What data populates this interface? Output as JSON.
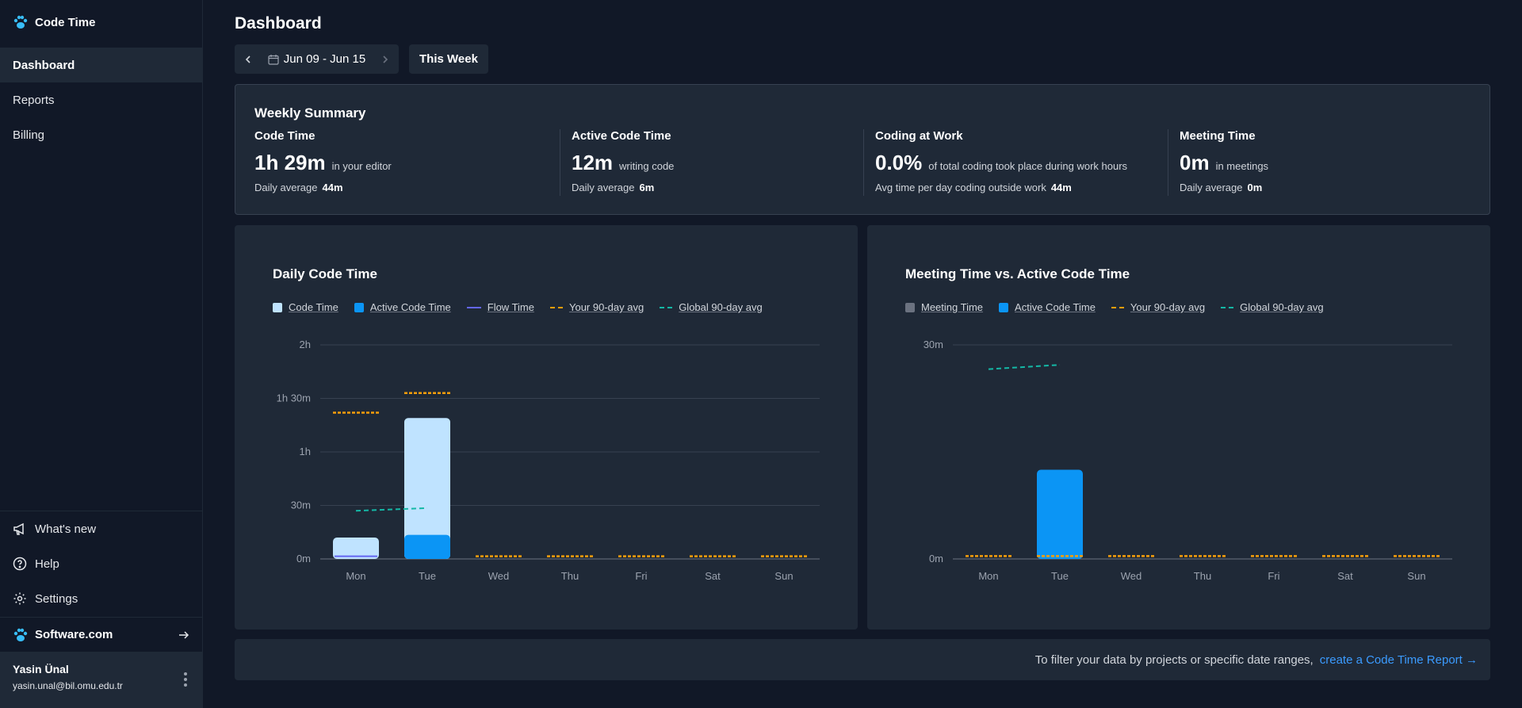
{
  "app": {
    "title": "Code Time"
  },
  "sidebar": {
    "nav": [
      {
        "label": "Dashboard",
        "active": true
      },
      {
        "label": "Reports"
      },
      {
        "label": "Billing"
      }
    ],
    "bottom": [
      {
        "label": "What's new",
        "icon": "megaphone-icon"
      },
      {
        "label": "Help",
        "icon": "help-icon"
      },
      {
        "label": "Settings",
        "icon": "gear-icon"
      }
    ],
    "software": "Software.com",
    "user": {
      "name": "Yasin Ünal",
      "email": "yasin.unal@bil.omu.edu.tr"
    }
  },
  "header": {
    "title": "Dashboard",
    "date_range": "Jun 09 - Jun 15",
    "this_week": "This Week"
  },
  "summary": {
    "title": "Weekly Summary",
    "metrics": [
      {
        "head": "Code Time",
        "value": "1h 29m",
        "sub": "in your editor",
        "avg_label": "Daily average",
        "avg": "44m"
      },
      {
        "head": "Active Code Time",
        "value": "12m",
        "sub": "writing code",
        "avg_label": "Daily average",
        "avg": "6m"
      },
      {
        "head": "Coding at Work",
        "value": "0.0%",
        "sub": "of total coding took place during work hours",
        "avg_label": "Avg time per day coding outside work",
        "avg": "44m"
      },
      {
        "head": "Meeting Time",
        "value": "0m",
        "sub": "in meetings",
        "avg_label": "Daily average",
        "avg": "0m"
      }
    ]
  },
  "colors": {
    "code_time": "#bfe3ff",
    "active_code_time": "#0b95f5",
    "flow_time": "#6366f1",
    "your_avg": "#f59e0b",
    "global_avg": "#14b8a6",
    "meeting_time": "#6b7280"
  },
  "chart_data": [
    {
      "type": "bar",
      "title": "Daily Code Time",
      "legend": [
        "Code Time",
        "Active Code Time",
        "Flow Time",
        "Your 90-day avg",
        "Global 90-day avg"
      ],
      "categories": [
        "Mon",
        "Tue",
        "Wed",
        "Thu",
        "Fri",
        "Sat",
        "Sun"
      ],
      "yticks": [
        "0m",
        "30m",
        "1h",
        "1h 30m",
        "2h"
      ],
      "ylim": [
        0,
        120
      ],
      "series": [
        {
          "name": "Code Time",
          "values": [
            12,
            79,
            0,
            0,
            0,
            0,
            0
          ]
        },
        {
          "name": "Active Code Time",
          "values": [
            0,
            13.5,
            0,
            0,
            0,
            0,
            0
          ]
        },
        {
          "name": "Flow Time",
          "values": [
            1.5,
            0,
            0,
            0,
            0,
            0,
            0
          ]
        },
        {
          "name": "Your 90-day avg",
          "values": [
            82,
            93,
            1.5,
            1.5,
            1.5,
            1.5,
            1.5
          ]
        },
        {
          "name": "Global 90-day avg",
          "values": [
            27,
            28.5,
            null,
            null,
            null,
            null,
            null
          ]
        }
      ]
    },
    {
      "type": "bar",
      "title": "Meeting Time vs. Active Code Time",
      "legend": [
        "Meeting Time",
        "Active Code Time",
        "Your 90-day avg",
        "Global 90-day avg"
      ],
      "categories": [
        "Mon",
        "Tue",
        "Wed",
        "Thu",
        "Fri",
        "Sat",
        "Sun"
      ],
      "yticks": [
        "0m",
        "30m"
      ],
      "ylim": [
        0,
        30
      ],
      "series": [
        {
          "name": "Meeting Time",
          "values": [
            0,
            0,
            0,
            0,
            0,
            0,
            0
          ]
        },
        {
          "name": "Active Code Time",
          "values": [
            0,
            12.5,
            0,
            0,
            0,
            0,
            0
          ]
        },
        {
          "name": "Your 90-day avg",
          "values": [
            0.4,
            0.4,
            0.4,
            0.4,
            0.4,
            0.4,
            0.4
          ]
        },
        {
          "name": "Global 90-day avg",
          "values": [
            26.6,
            27.2,
            null,
            null,
            null,
            null,
            null
          ]
        }
      ]
    }
  ],
  "footer": {
    "text": "To filter your data by projects or specific date ranges,",
    "link": "create a Code Time Report →"
  }
}
